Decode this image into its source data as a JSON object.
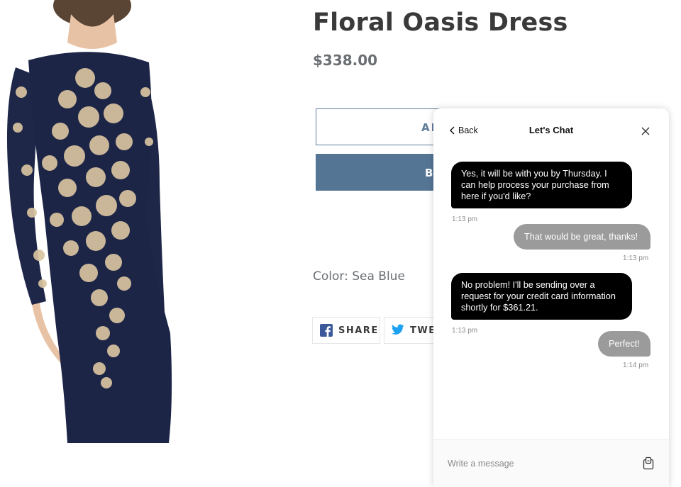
{
  "product": {
    "title": "Floral Oasis Dress",
    "price": "$338.00",
    "add_to_cart_label": "AD",
    "buy_now_label": "B",
    "color_label": "Color: Sea Blue",
    "image_icon": "dress-photo"
  },
  "share": {
    "facebook_label": "SHARE",
    "facebook_icon": "facebook-icon",
    "twitter_label": "TWE",
    "twitter_icon": "twitter-icon"
  },
  "chat": {
    "back_label": "Back",
    "title": "Let's Chat",
    "input_placeholder": "Write a message",
    "messages": [
      {
        "from": "agent",
        "text": "Yes, it will be with you by Thursday. I can help process your purchase from here if you'd like?",
        "time": "1:13 pm"
      },
      {
        "from": "user",
        "text": "That would be great, thanks!",
        "time": "1:13 pm"
      },
      {
        "from": "agent",
        "text": "No problem! I'll be sending over a request for your credit card information shortly for $361.21.",
        "time": "1:13 pm"
      },
      {
        "from": "user",
        "text": "Perfect!",
        "time": "1:14 pm"
      }
    ]
  },
  "colors": {
    "accent": "#557595",
    "agent_bubble": "#000000",
    "user_bubble": "#9b9b9b",
    "dress_navy": "#1d2547",
    "lace_gold": "#d9c4a0"
  }
}
